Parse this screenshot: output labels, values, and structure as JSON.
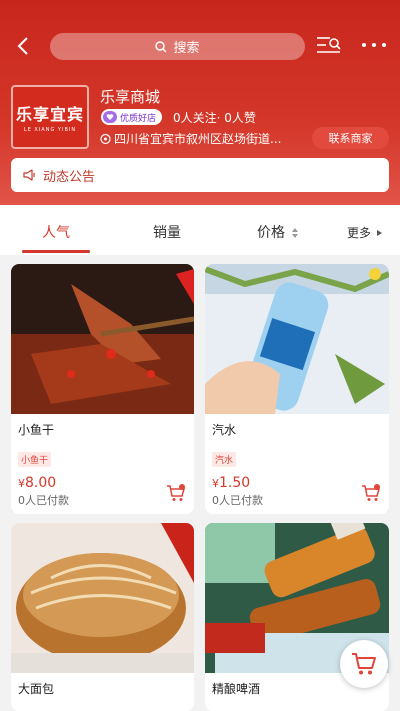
{
  "header": {
    "search_placeholder": "搜索",
    "shop_name": "乐享商城",
    "logo_text": "乐享宜宾",
    "logo_subtext": "LE XIANG YIBIN",
    "badge_label": "优质好店",
    "follow_stats": "0人关注· 0人赞",
    "address": "四川省宜宾市叙州区赵场街道...",
    "contact_button": "联系商家",
    "notice_label": "动态公告",
    "accent_color": "#d4382a"
  },
  "tabs": [
    {
      "label": "人气",
      "active": true
    },
    {
      "label": "销量",
      "active": false
    },
    {
      "label": "价格",
      "active": false
    },
    {
      "label": "更多",
      "active": false
    }
  ],
  "products": [
    {
      "name": "小鱼干",
      "tag": "小鱼干",
      "currency": "¥",
      "price": "8.00",
      "sold": "0人已付款"
    },
    {
      "name": "汽水",
      "tag": "汽水",
      "currency": "¥",
      "price": "1.50",
      "sold": "0人已付款"
    },
    {
      "name": "大面包"
    },
    {
      "name": "精酿啤酒"
    }
  ],
  "icons": [
    "back-icon",
    "search-icon",
    "list-search-icon",
    "more-icon",
    "verified-heart-icon",
    "location-icon",
    "megaphone-icon",
    "sort-icon",
    "triangle-right-icon",
    "cart-icon"
  ]
}
